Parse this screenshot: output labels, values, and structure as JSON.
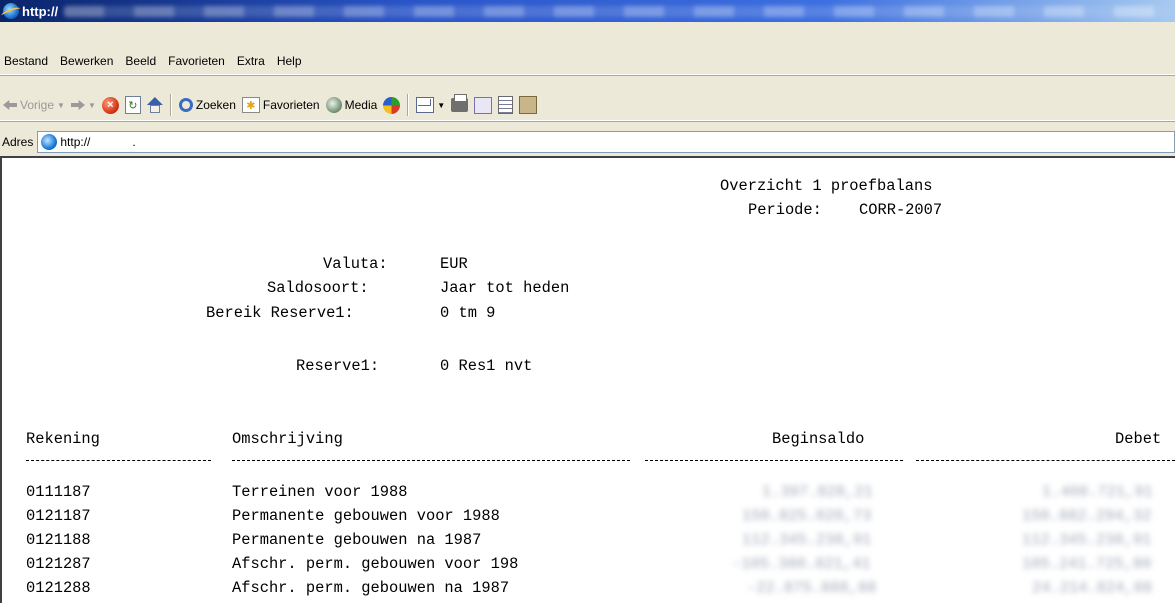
{
  "window": {
    "title": "http://"
  },
  "menu": [
    "Bestand",
    "Bewerken",
    "Beeld",
    "Favorieten",
    "Extra",
    "Help"
  ],
  "toolbar": {
    "back_label": "Vorige",
    "search_label": "Zoeken",
    "favorites_label": "Favorieten",
    "media_label": "Media"
  },
  "address": {
    "label": "Adres",
    "url": "http://",
    "cursor_text": "."
  },
  "report": {
    "title": "Overzicht 1 proefbalans",
    "period_label": "Periode:",
    "period_value": "CORR-2007",
    "params": [
      {
        "label": "Valuta:",
        "value": "EUR"
      },
      {
        "label": "Saldosoort:",
        "value": "Jaar tot heden"
      },
      {
        "label": "Bereik Reserve1:",
        "value": "0 tm 9"
      },
      {
        "label": "Reserve1:",
        "value": "0 Res1 nvt"
      }
    ],
    "columns": {
      "account": "Rekening",
      "description": "Omschrijving",
      "opening": "Beginsaldo",
      "debit": "Debet"
    },
    "rows": [
      {
        "account": "0111187",
        "description": "Terreinen voor 1988",
        "opening": "1.397.828,21",
        "debit": "1.408.721,91"
      },
      {
        "account": "0121187",
        "description": "Permanente gebouwen voor 1988",
        "opening": "150.825.020,73",
        "debit": "150.882.294,32"
      },
      {
        "account": "0121188",
        "description": "Permanente gebouwen na 1987",
        "opening": "112.345.238,91",
        "debit": "112.345.238,91"
      },
      {
        "account": "0121287",
        "description": "Afschr. perm. gebouwen voor 198",
        "opening": "-105.380.821,41",
        "debit": "105.241.725,80"
      },
      {
        "account": "0121288",
        "description": "Afschr. perm. gebouwen na 1987",
        "opening": "-22.875.888,88",
        "debit": "24.214.824,88"
      }
    ]
  }
}
